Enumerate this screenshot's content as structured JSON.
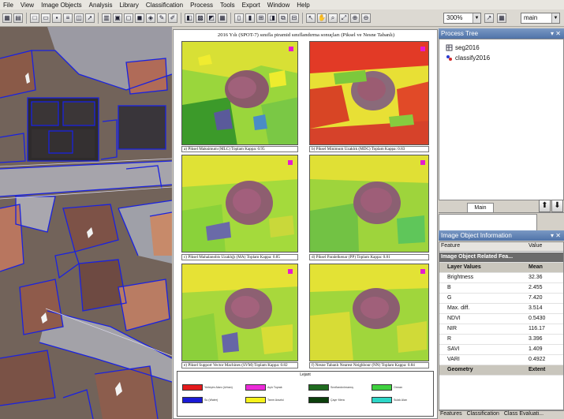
{
  "menu": [
    "File",
    "View",
    "Image Objects",
    "Analysis",
    "Library",
    "Classification",
    "Process",
    "Tools",
    "Export",
    "Window",
    "Help"
  ],
  "toolbar": {
    "zoom_value": "300%",
    "map_value": "main"
  },
  "figure": {
    "title": "2016 Yılı (SPOT-7) sınıfla piramid sınıflandırma sonuçları (Piksel ve Nesne Tabanlı)",
    "captions": [
      "a) Piksel Maksimum (MLC)  Toplam Kappa: 0.95",
      "b) Piksel Minimum Uzaklık (MDC)  Toplam Kappa: 0.83",
      "c) Piksel Mahalanobis Uzaklığı (MA)  Toplam Kappa: 0.85",
      "d) Piksel Paralelkenar (PP)  Toplam Kappa: 0.81",
      "e) Piksel Support Vector Machines (SVM)  Toplam Kappa: 0.82",
      "f) Nesne Tabanlı Nearest Neighbour (NN)  Toplam Kappa: 0.84"
    ],
    "legend_title": "Lejant",
    "legend_items": [
      {
        "label": "Yerleşim Alanı (Urban)",
        "color": "#e41a1c"
      },
      {
        "label": "Açık Toprak",
        "color": "#ec2bd9"
      },
      {
        "label": "Sınıflandırılmamış",
        "color": "#1f6b1f"
      },
      {
        "label": "Orman",
        "color": "#3fd13f"
      },
      {
        "label": "Su (Water)",
        "color": "#1a1ad6"
      },
      {
        "label": "Tarım Arazisi",
        "color": "#f7f21c"
      },
      {
        "label": "Çayır Mera",
        "color": "#0c3f0c"
      },
      {
        "label": "Sulak Alan",
        "color": "#2dd6c7"
      }
    ]
  },
  "process_tree": {
    "title": "Process Tree",
    "items": [
      "seg2016",
      "classify2016"
    ]
  },
  "tabs": {
    "main": "Main"
  },
  "info": {
    "title": "Image Object Information",
    "col_feature": "Feature",
    "col_value": "Value",
    "group": "Image Object Related Fea...",
    "layer_values": "Layer Values",
    "layer_values_col": "Mean",
    "rows": [
      {
        "feature": "Brightness",
        "value": "32.36"
      },
      {
        "feature": "B",
        "value": "2.455"
      },
      {
        "feature": "G",
        "value": "7.420"
      },
      {
        "feature": "Max. diff.",
        "value": "3.514"
      },
      {
        "feature": "NDVI",
        "value": "0.5430"
      },
      {
        "feature": "NIR",
        "value": "116.17"
      },
      {
        "feature": "R",
        "value": "3.396"
      },
      {
        "feature": "SAVI",
        "value": "1.409"
      },
      {
        "feature": "VARI",
        "value": "0.4922"
      }
    ],
    "geometry": "Geometry",
    "geometry_col": "Extent"
  },
  "bottom_tabs": [
    "Features",
    "Classification",
    "Class Evaluati..."
  ]
}
